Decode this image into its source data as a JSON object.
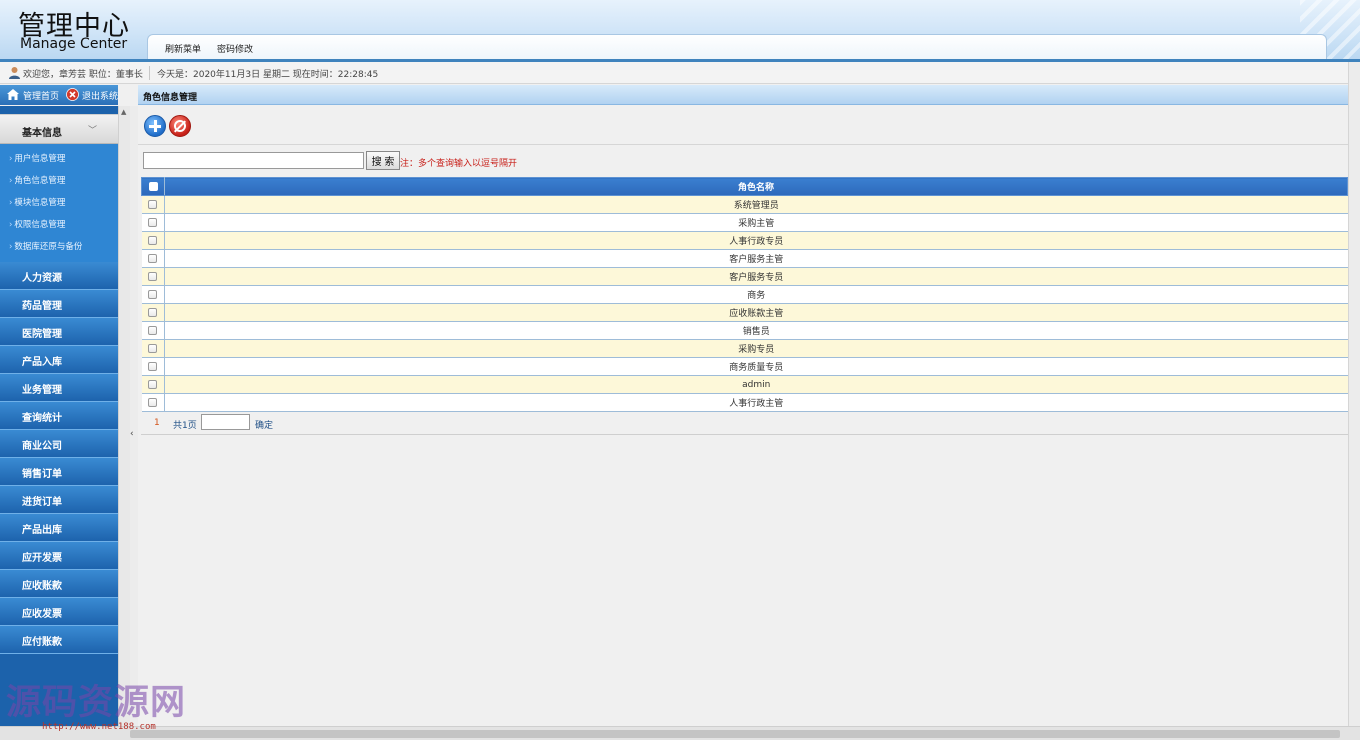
{
  "header": {
    "title_cn": "管理中心",
    "title_en": "Manage Center",
    "nav": [
      "刷新菜单",
      "密码修改"
    ]
  },
  "infobar": {
    "welcome": "欢迎您，章芳芸 职位：董事长",
    "today": "今天是：2020年11月3日 星期二 现在时间：22:28:45"
  },
  "left_top": {
    "home": "管理首页",
    "logout": "退出系统"
  },
  "sidebar": {
    "basic": "基本信息",
    "sub_items": [
      "用户信息管理",
      "角色信息管理",
      "模块信息管理",
      "权限信息管理",
      "数据库还原与备份"
    ],
    "items": [
      "人力资源",
      "药品管理",
      "医院管理",
      "产品入库",
      "业务管理",
      "查询统计",
      "商业公司",
      "销售订单",
      "进货订单",
      "产品出库",
      "应开发票",
      "应收账款",
      "应收发票",
      "应付账款"
    ]
  },
  "main": {
    "title": "角色信息管理",
    "search_button": "搜 索",
    "search_hint": "注：多个查询输入以逗号隔开",
    "table": {
      "header": "角色名称",
      "rows": [
        "系统管理员",
        "采购主管",
        "人事行政专员",
        "客户服务主管",
        "客户服务专员",
        "商务",
        "应收账款主管",
        "销售员",
        "采购专员",
        "商务质量专员",
        "admin",
        "人事行政主管"
      ]
    },
    "pager": {
      "current": "1",
      "total": "共1页",
      "confirm": "确定"
    }
  },
  "watermark": {
    "text": "源码资源网",
    "url": "http://www.net188.com"
  },
  "colors": {
    "sidebar_blue": "#1c62ab",
    "table_header": "#2d69bb",
    "row_odd": "#fdf8d9",
    "hint_red": "#c8201a"
  }
}
